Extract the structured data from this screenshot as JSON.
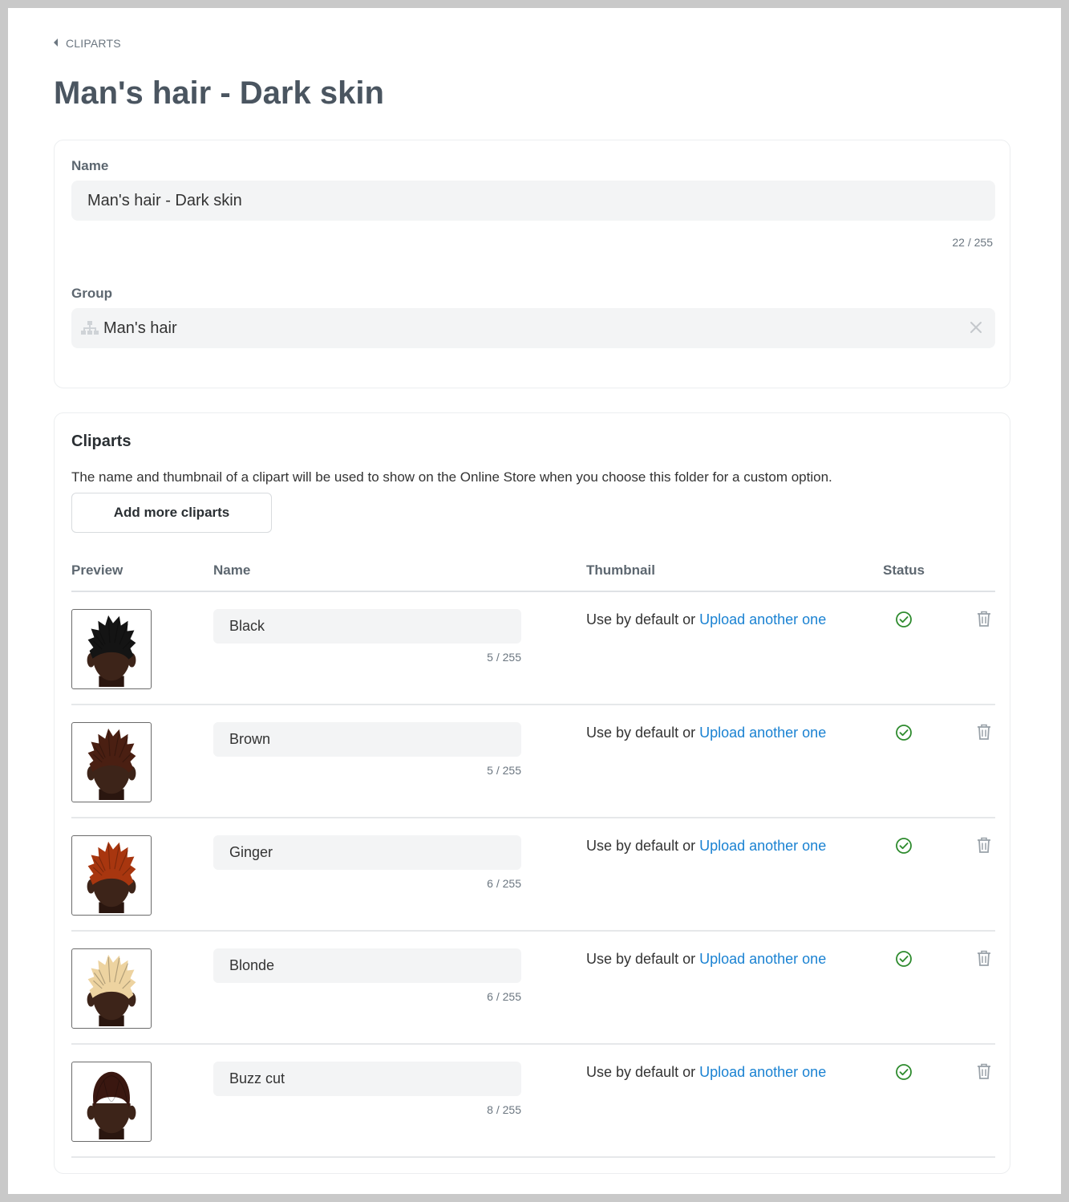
{
  "breadcrumb": {
    "label": "CLIPARTS",
    "icon": "caret-left-icon"
  },
  "page_title": "Man's hair - Dark skin",
  "details": {
    "name_label": "Name",
    "name_value": "Man's hair - Dark skin",
    "name_counter": "22 / 255",
    "group_label": "Group",
    "group_value": "Man's hair",
    "group_icon": "hierarchy-icon",
    "clear_icon": "close-icon"
  },
  "cliparts": {
    "title": "Cliparts",
    "description": "The name and thumbnail of a clipart will be used to show on the Online Store when you choose this folder for a custom option.",
    "add_button_label": "Add more cliparts",
    "columns": {
      "preview": "Preview",
      "name": "Name",
      "thumbnail": "Thumbnail",
      "status": "Status"
    },
    "thumbnail_prefix": "Use by default or ",
    "upload_link": "Upload another one",
    "status_icon": "check-circle-icon",
    "delete_icon": "trash-icon",
    "status_color": "#2e8b2e",
    "link_color": "#1a82d2",
    "items": [
      {
        "name": "Black",
        "counter": "5 / 255",
        "hair_color": "#141414",
        "style": "spiky"
      },
      {
        "name": "Brown",
        "counter": "5 / 255",
        "hair_color": "#4a1f12",
        "style": "spiky"
      },
      {
        "name": "Ginger",
        "counter": "6 / 255",
        "hair_color": "#a8360f",
        "style": "spiky"
      },
      {
        "name": "Blonde",
        "counter": "6 / 255",
        "hair_color": "#edd3a0",
        "style": "spiky"
      },
      {
        "name": "Buzz cut",
        "counter": "8 / 255",
        "hair_color": "#3a1710",
        "style": "buzz"
      }
    ]
  }
}
